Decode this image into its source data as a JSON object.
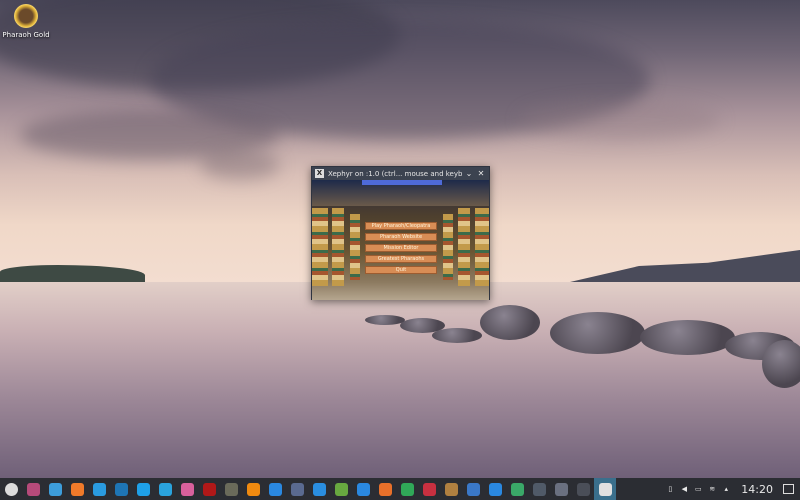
{
  "desktop": {
    "icons": [
      {
        "label": "Pharaoh Gold",
        "icon": "pharaoh-gold-icon"
      }
    ]
  },
  "window": {
    "title": "Xephyr on :1.0 (ctrl... mouse and keyboard)",
    "minimize": "⌄",
    "close": "✕",
    "game_menu": [
      "Play Pharaoh/Cleopatra",
      "Pharaoh Website",
      "Mission Editor",
      "Greatest Pharaohs",
      "Quit"
    ]
  },
  "taskbar": {
    "apps": [
      {
        "name": "app-launcher",
        "color": "#dcdcdc"
      },
      {
        "name": "system-monitor",
        "color": "#b64a7a"
      },
      {
        "name": "file-manager",
        "color": "#3d9ddb"
      },
      {
        "name": "firefox",
        "color": "#f07a2a"
      },
      {
        "name": "edge",
        "color": "#2a9be0"
      },
      {
        "name": "steam",
        "color": "#1e75b5"
      },
      {
        "name": "skype",
        "color": "#1ea0e8"
      },
      {
        "name": "telegram",
        "color": "#2aa3dd"
      },
      {
        "name": "pink-app",
        "color": "#d8609c"
      },
      {
        "name": "red-app",
        "color": "#b01818"
      },
      {
        "name": "game-app",
        "color": "#6a6a5a"
      },
      {
        "name": "vlc",
        "color": "#f08a10"
      },
      {
        "name": "headphones-app",
        "color": "#2a88e0"
      },
      {
        "name": "audio-app",
        "color": "#5a6a90"
      },
      {
        "name": "network-app",
        "color": "#2a8ee0"
      },
      {
        "name": "editor-app",
        "color": "#68a840"
      },
      {
        "name": "document",
        "color": "#2a88e0"
      },
      {
        "name": "presentation",
        "color": "#e8702a"
      },
      {
        "name": "spreadsheet",
        "color": "#30a858"
      },
      {
        "name": "kdenlive",
        "color": "#c83040"
      },
      {
        "name": "library",
        "color": "#b08040"
      },
      {
        "name": "word-app",
        "color": "#3a78c8"
      },
      {
        "name": "store",
        "color": "#2a88e0"
      },
      {
        "name": "stocks",
        "color": "#3aa868"
      },
      {
        "name": "calculator",
        "color": "#505a68"
      },
      {
        "name": "mixer",
        "color": "#6a7080"
      },
      {
        "name": "terminal",
        "color": "#4a4e58"
      },
      {
        "name": "xephyr",
        "color": "#e0e0e0",
        "active": true
      }
    ],
    "tray": [
      "battery-icon",
      "volume-icon",
      "display-icon",
      "wifi-icon",
      "arrow-up-icon"
    ],
    "clock": "14:20"
  }
}
